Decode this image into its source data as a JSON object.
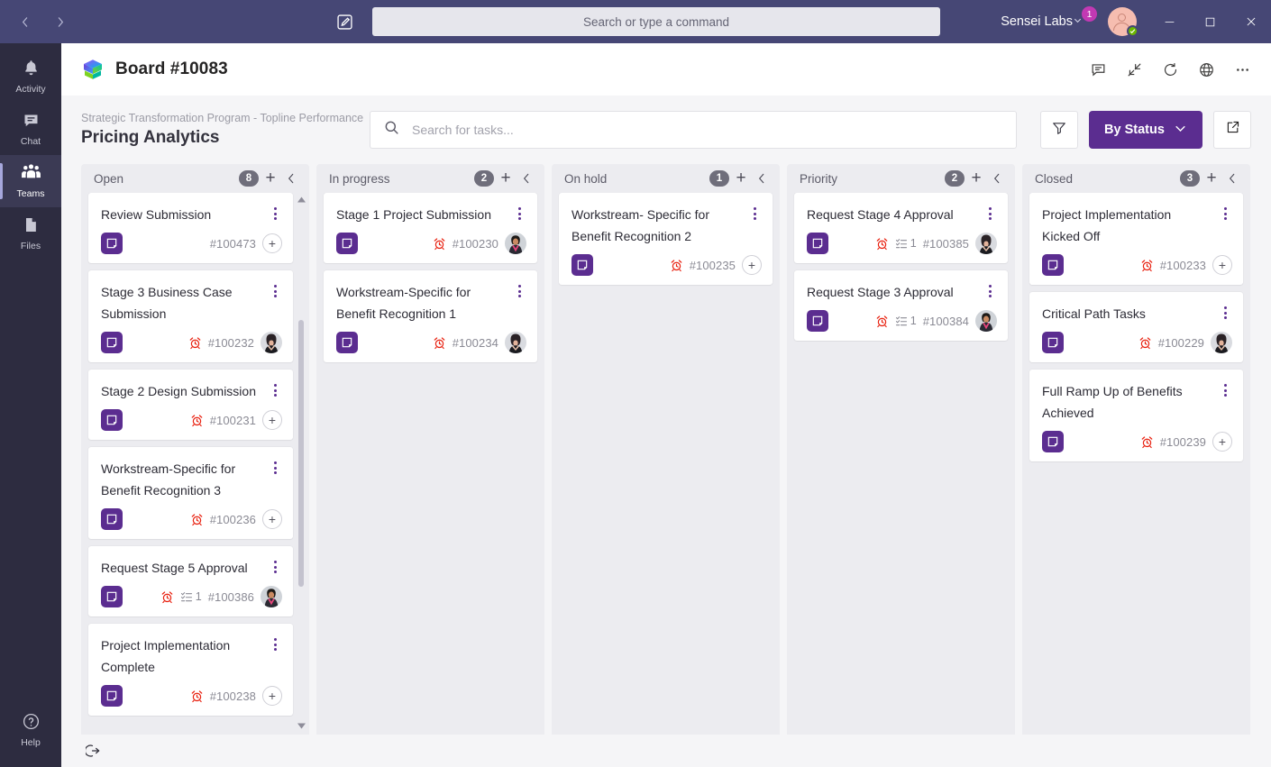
{
  "titlebar": {
    "back_icon": "chevron-left-icon",
    "forward_icon": "chevron-right-icon",
    "compose_icon": "compose-icon",
    "command_search_placeholder": "Search or type a command",
    "org_name": "Sensei Labs",
    "org_badge_count": "1",
    "minimize_label": "—",
    "maximize_label": "□",
    "close_label": "×"
  },
  "rail": {
    "items": [
      {
        "label": "Activity",
        "icon": "bell-icon",
        "active": false
      },
      {
        "label": "Chat",
        "icon": "chat-icon",
        "active": false
      },
      {
        "label": "Teams",
        "icon": "teams-icon",
        "active": true
      },
      {
        "label": "Files",
        "icon": "files-icon",
        "active": false
      }
    ],
    "help_label": "Help",
    "help_icon": "question-circle-icon"
  },
  "board_header": {
    "title": "Board #10083",
    "logo_icon": "sensei-labs-cube-logo",
    "actions": [
      {
        "name": "comment-icon"
      },
      {
        "name": "collapse-icon"
      },
      {
        "name": "refresh-icon"
      },
      {
        "name": "globe-icon"
      },
      {
        "name": "more-options-icon"
      }
    ]
  },
  "sub_header": {
    "breadcrumb": "Strategic Transformation Program - Topline Performance",
    "page_title": "Pricing Analytics",
    "search_placeholder": "Search for tasks...",
    "search_icon": "search-icon",
    "filter_icon": "filter-icon",
    "group_by_label": "By Status",
    "group_by_chevron": "chevron-down-icon",
    "expand_icon": "external-link-icon",
    "accent_color": "#5b2d90"
  },
  "board": {
    "footer_icon": "export-icon",
    "columns": [
      {
        "name": "Open",
        "count": "8",
        "add_icon": "plus-icon",
        "collapse_icon": "chevron-left-icon",
        "has_scrollbar": true,
        "cards": [
          {
            "title": "Review Submission",
            "id": "#100473",
            "alarm": false,
            "subtasks": null,
            "trailing": "add"
          },
          {
            "title": "Stage 3 Business Case Submission",
            "id": "#100232",
            "alarm": true,
            "subtasks": null,
            "trailing": "avatar",
            "avatar": "woman-dark-hair"
          },
          {
            "title": "Stage 2 Design Submission",
            "id": "#100231",
            "alarm": true,
            "subtasks": null,
            "trailing": "add"
          },
          {
            "title": "Workstream-Specific for Benefit Recognition 3",
            "id": "#100236",
            "alarm": true,
            "subtasks": null,
            "trailing": "add"
          },
          {
            "title": "Request Stage 5 Approval",
            "id": "#100386",
            "alarm": true,
            "subtasks": "1",
            "trailing": "avatar",
            "avatar": "person-pink-collar"
          },
          {
            "title": "Project Implementation Complete",
            "id": "#100238",
            "alarm": true,
            "subtasks": null,
            "trailing": "add"
          }
        ]
      },
      {
        "name": "In progress",
        "count": "2",
        "add_icon": "plus-icon",
        "collapse_icon": "chevron-left-icon",
        "has_scrollbar": false,
        "cards": [
          {
            "title": "Stage 1 Project Submission",
            "id": "#100230",
            "alarm": true,
            "subtasks": null,
            "trailing": "avatar",
            "avatar": "person-pink-collar"
          },
          {
            "title": "Workstream-Specific for Benefit Recognition 1",
            "id": "#100234",
            "alarm": true,
            "subtasks": null,
            "trailing": "avatar",
            "avatar": "woman-dark-hair"
          }
        ]
      },
      {
        "name": "On hold",
        "count": "1",
        "add_icon": "plus-icon",
        "collapse_icon": "chevron-left-icon",
        "has_scrollbar": false,
        "cards": [
          {
            "title": "Workstream- Specific for Benefit Recognition 2",
            "id": "#100235",
            "alarm": true,
            "subtasks": null,
            "trailing": "add"
          }
        ]
      },
      {
        "name": "Priority",
        "count": "2",
        "add_icon": "plus-icon",
        "collapse_icon": "chevron-left-icon",
        "has_scrollbar": false,
        "cards": [
          {
            "title": "Request Stage 4 Approval",
            "id": "#100385",
            "alarm": true,
            "subtasks": "1",
            "trailing": "avatar",
            "avatar": "woman-dark-hair"
          },
          {
            "title": "Request Stage 3 Approval",
            "id": "#100384",
            "alarm": true,
            "subtasks": "1",
            "trailing": "avatar",
            "avatar": "person-pink-collar"
          }
        ]
      },
      {
        "name": "Closed",
        "count": "3",
        "add_icon": "plus-icon",
        "collapse_icon": "chevron-left-icon",
        "has_scrollbar": false,
        "cards": [
          {
            "title": "Project Implementation Kicked Off",
            "id": "#100233",
            "alarm": true,
            "subtasks": null,
            "trailing": "add"
          },
          {
            "title": "Critical Path Tasks",
            "id": "#100229",
            "alarm": true,
            "subtasks": null,
            "trailing": "avatar",
            "avatar": "woman-dark-hair"
          },
          {
            "title": "Full Ramp Up of Benefits Achieved",
            "id": "#100239",
            "alarm": true,
            "subtasks": null,
            "trailing": "add"
          }
        ]
      }
    ]
  }
}
